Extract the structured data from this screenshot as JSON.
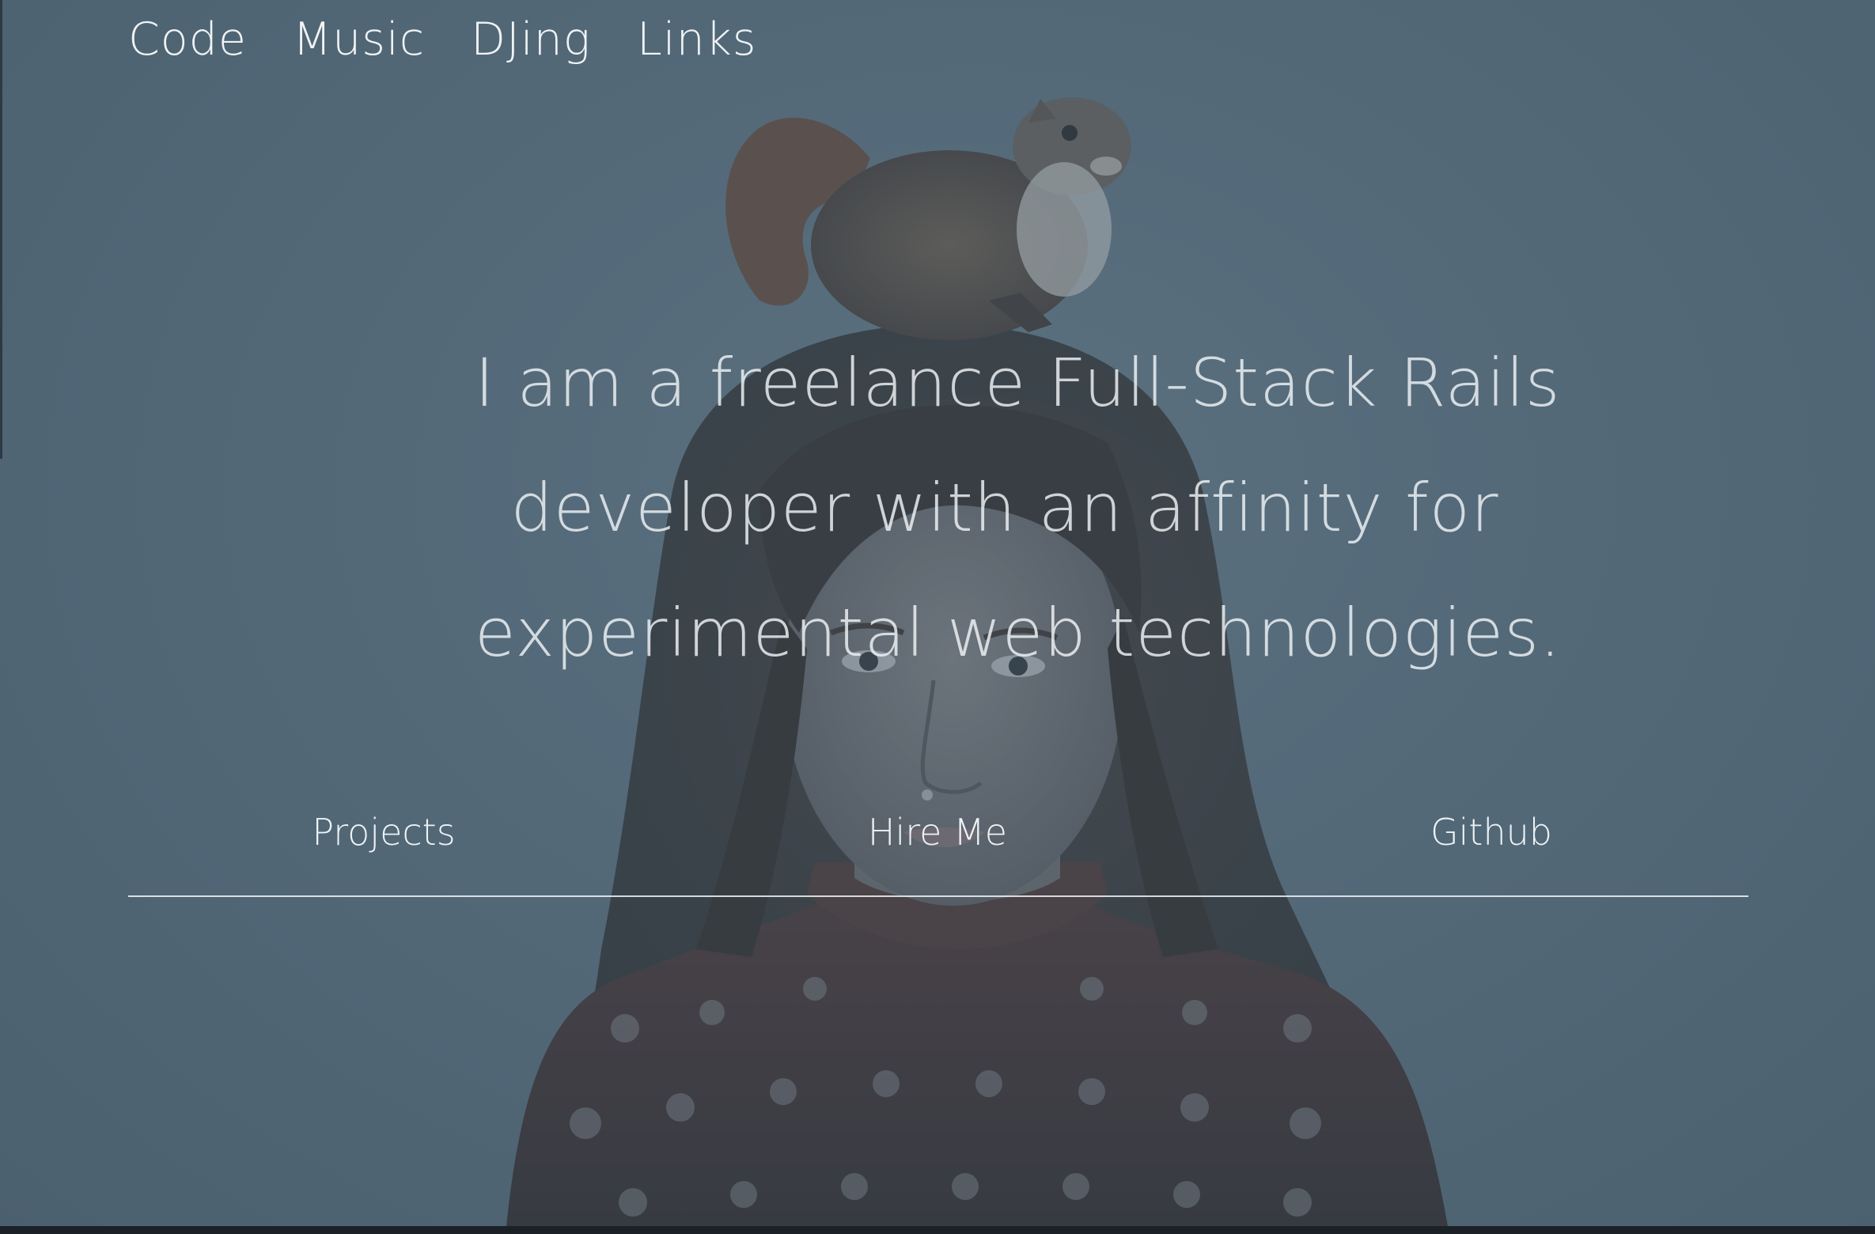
{
  "nav": {
    "items": [
      {
        "label": "Code"
      },
      {
        "label": "Music"
      },
      {
        "label": "DJing"
      },
      {
        "label": "Links"
      }
    ]
  },
  "hero": {
    "lines": [
      "I am a freelance Full-Stack Rails",
      "developer with an affinity for",
      "experimental web technologies."
    ]
  },
  "links": {
    "projects": "Projects",
    "hire_me": "Hire Me",
    "github": "Github"
  },
  "colors": {
    "overlay": "#5d717e",
    "text": "#eef2f5",
    "divider": "#eef2f5"
  }
}
